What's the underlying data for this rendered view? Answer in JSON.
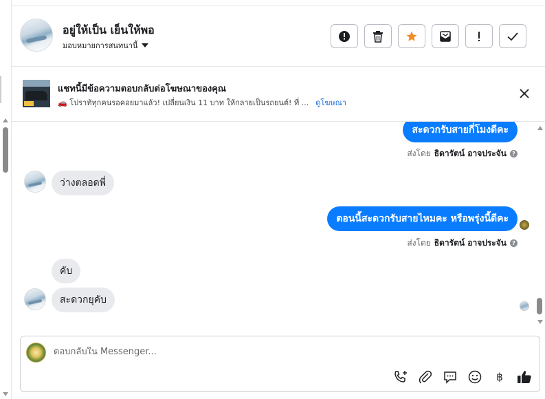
{
  "header": {
    "contact_name": "อยู่ให้เป็น เย็นให้พอ",
    "assign_label": "มอบหมายการสนทนานี้",
    "actions": [
      {
        "name": "spam-button",
        "icon": "alert-circle-icon"
      },
      {
        "name": "delete-button",
        "icon": "trash-icon"
      },
      {
        "name": "star-button",
        "icon": "star-icon",
        "color": "#f28c28"
      },
      {
        "name": "mark-unread-button",
        "icon": "envelope-icon"
      },
      {
        "name": "follow-up-button",
        "icon": "exclamation-icon"
      },
      {
        "name": "mark-done-button",
        "icon": "checkmark-icon"
      }
    ]
  },
  "ad": {
    "title": "แชทนี้มีข้อความตอบกลับต่อโฆษณาของคุณ",
    "subtitle": "🚗 โปราท้ทุกคนรอคอยมาแล้ว! เปลี่ยนเงิน 11 บาท ให้กลายเป็นรถยนต์! ที่ ...",
    "link": "ดูโฆษณา"
  },
  "messages": {
    "out1": "สะดวกรับสายกี่โมงดีคะ",
    "sent_prefix": "ส่งโดย",
    "sent_by": "ธิดารัตน์ อาจประจัน",
    "in1": "ว่างตลอดพี่",
    "out2": "ตอนนี้สะดวกรับสายไหมคะ หรือพรุ่งนี้ดีคะ",
    "in2": "คับ",
    "in3": "สะดวกยุคับ"
  },
  "composer": {
    "placeholder": "ตอบกลับใน Messenger...",
    "tools": [
      "call-add-icon",
      "paperclip-icon",
      "saved-reply-icon",
      "emoji-icon",
      "baht-icon",
      "thumbs-up-icon"
    ],
    "baht_symbol": "฿"
  },
  "colors": {
    "accent": "#0a7cff",
    "link": "#216fdb",
    "star": "#f28c28"
  }
}
